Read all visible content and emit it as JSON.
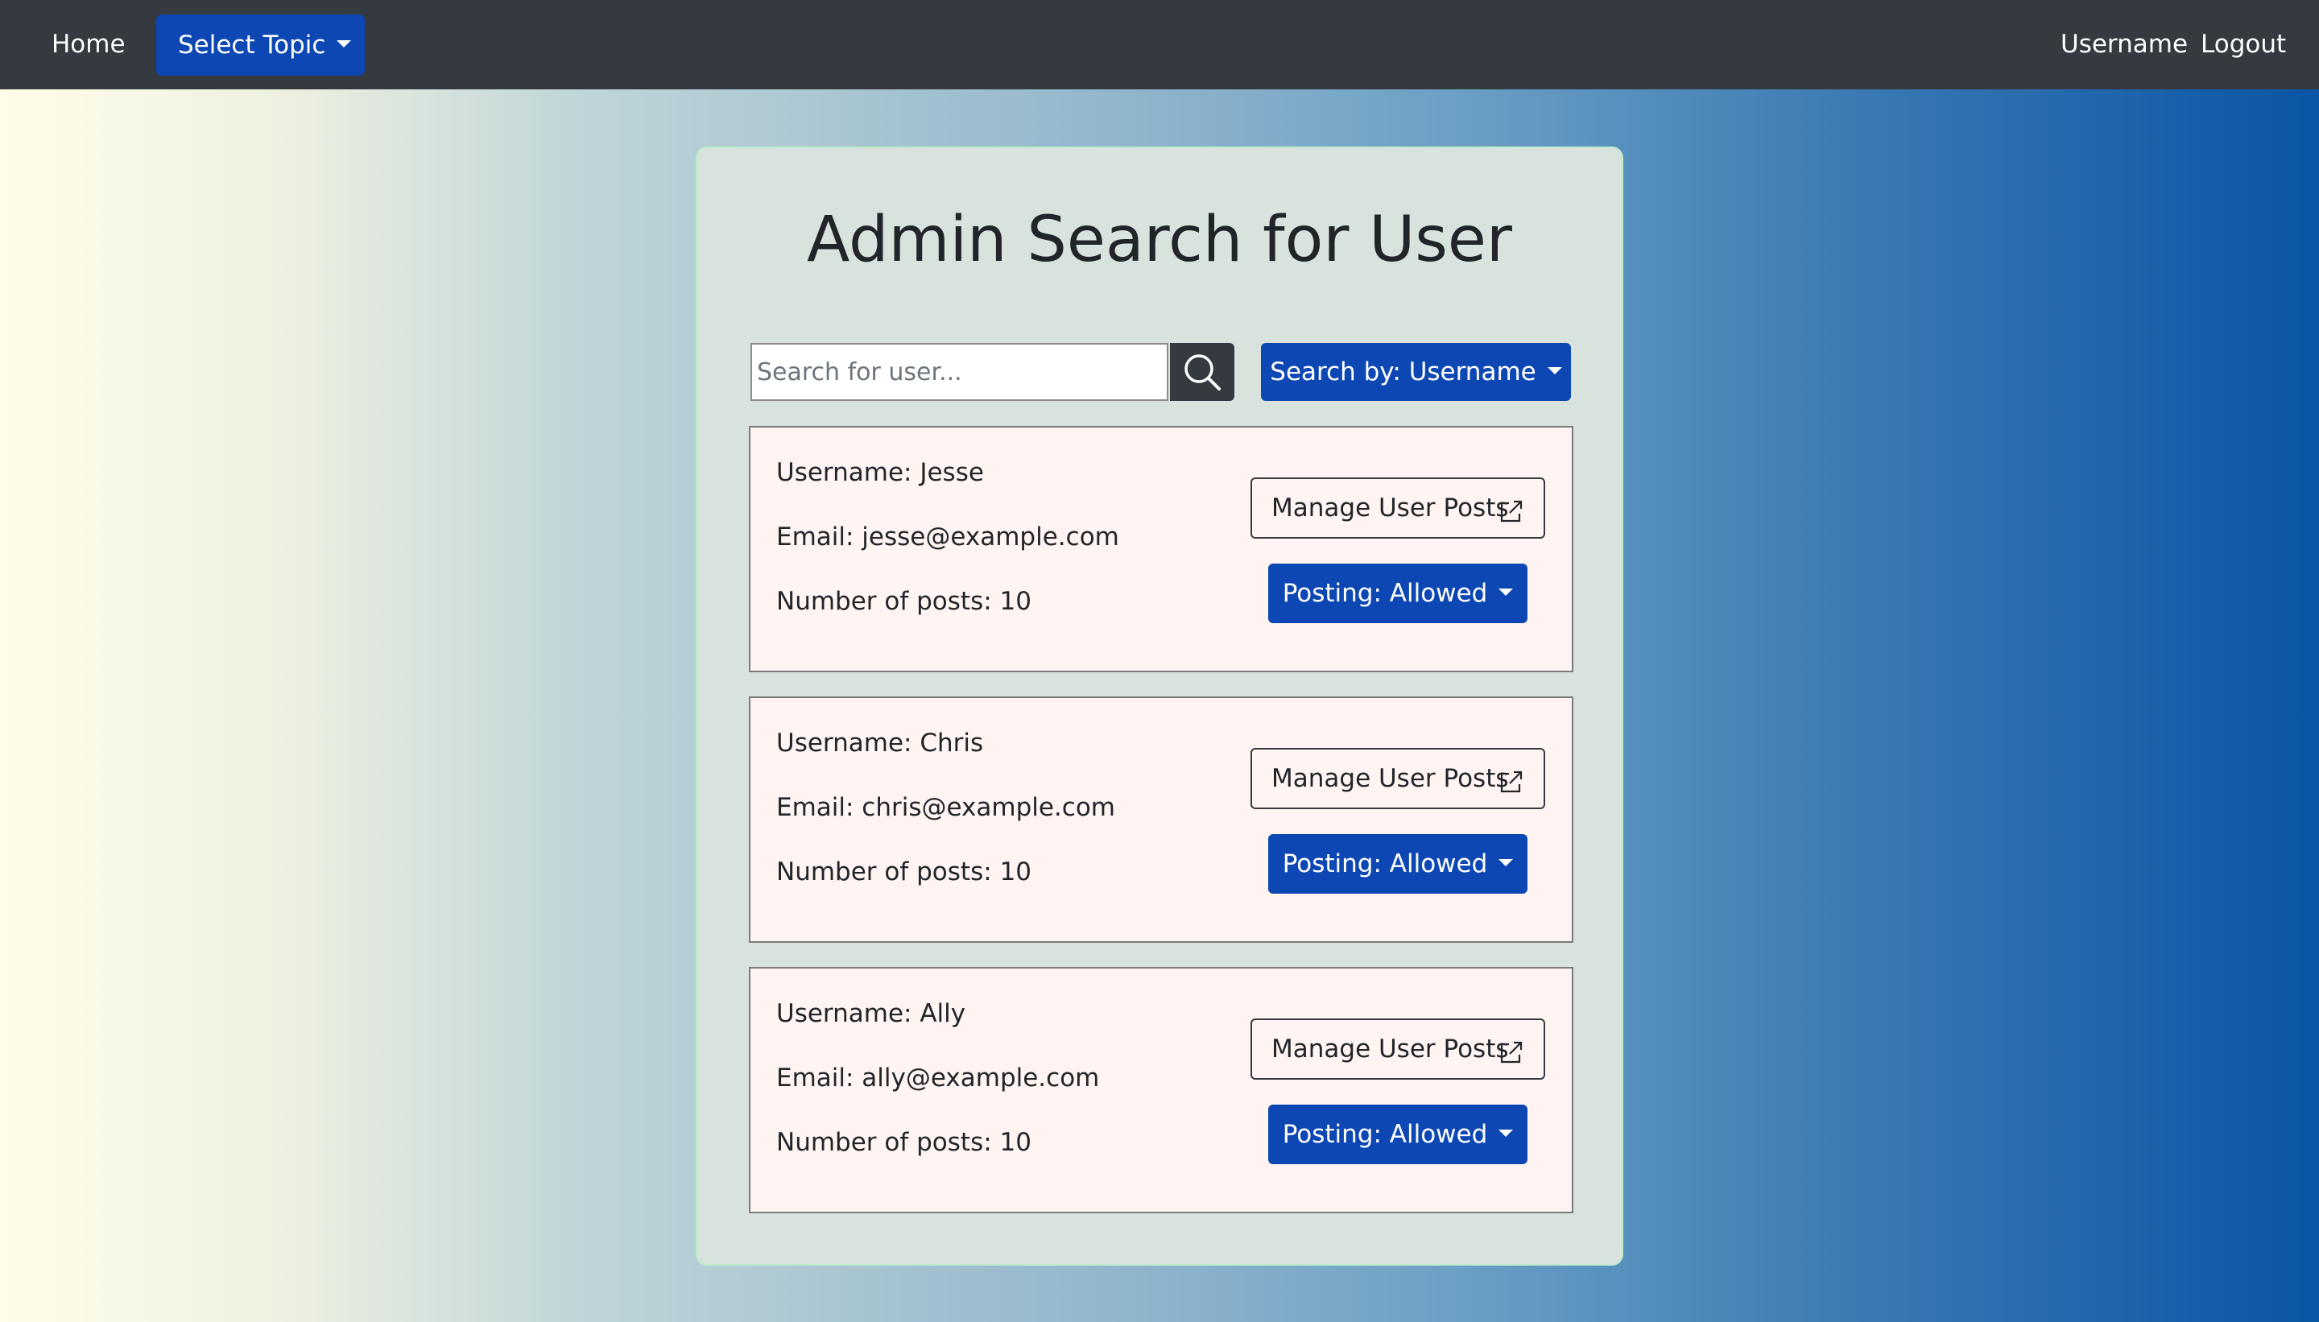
{
  "nav": {
    "home": "Home",
    "select_topic": "Select Topic",
    "username": "Username",
    "logout": "Logout"
  },
  "page": {
    "title": "Admin Search for User"
  },
  "search": {
    "placeholder": "Search for user...",
    "search_by": "Search by: Username"
  },
  "users": [
    {
      "username": "Username: Jesse",
      "email": "Email: jesse@example.com",
      "posts": "Number of posts: 10",
      "manage_label": "Manage User Posts",
      "posting_label": "Posting: Allowed"
    },
    {
      "username": "Username: Chris",
      "email": "Email: chris@example.com",
      "posts": "Number of posts: 10",
      "manage_label": "Manage User Posts",
      "posting_label": "Posting: Allowed"
    },
    {
      "username": "Username: Ally",
      "email": "Email: ally@example.com",
      "posts": "Number of posts: 10",
      "manage_label": "Manage User Posts",
      "posting_label": "Posting: Allowed"
    }
  ],
  "colors": {
    "navbar": "#343a40",
    "primary": "#0d47b3",
    "card": "#d8e3dd",
    "user_card": "#fff4f2"
  },
  "icons": {
    "search": "search-icon",
    "external_link": "external-link-icon",
    "caret": "caret-down-icon"
  }
}
